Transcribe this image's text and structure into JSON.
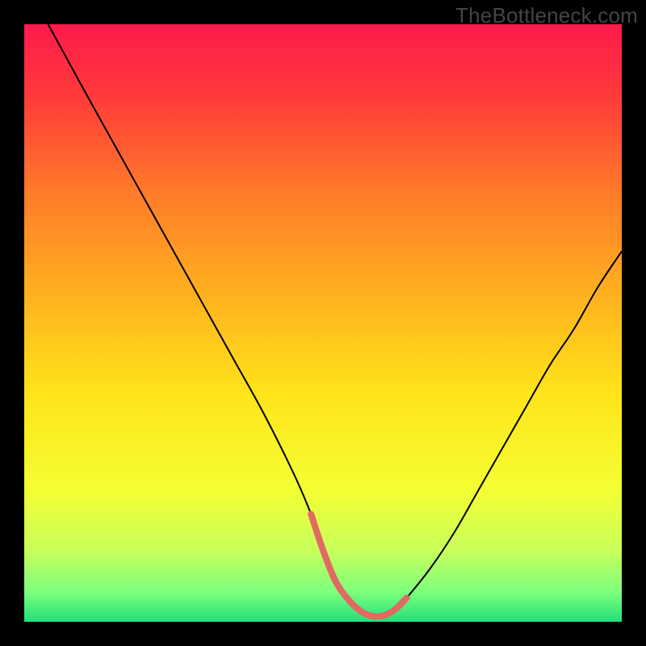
{
  "watermark": "TheBottleneck.com",
  "chart_data": {
    "type": "line",
    "title": "",
    "xlabel": "",
    "ylabel": "",
    "xlim": [
      0,
      100
    ],
    "ylim": [
      0,
      100
    ],
    "grid": false,
    "series": [
      {
        "name": "curve",
        "color": "#000000",
        "x": [
          4,
          10,
          15,
          20,
          25,
          30,
          35,
          40,
          45,
          48,
          50,
          52,
          54,
          56,
          58,
          60,
          62,
          64,
          68,
          72,
          76,
          80,
          84,
          88,
          92,
          96,
          100
        ],
        "y": [
          100,
          89,
          80,
          71,
          62,
          53,
          44,
          35,
          25,
          18,
          12,
          7,
          4,
          2,
          1,
          1,
          2,
          4,
          9,
          15,
          22,
          29,
          36,
          43,
          49,
          56,
          62
        ]
      },
      {
        "name": "highlight",
        "color": "#e16a62",
        "x": [
          48,
          50,
          52,
          54,
          56,
          58,
          60,
          62,
          64
        ],
        "y": [
          18,
          12,
          7,
          4,
          2,
          1,
          1,
          2,
          4
        ]
      }
    ],
    "gradient_stops": [
      {
        "offset": 0.0,
        "color": "#ff1a4d"
      },
      {
        "offset": 0.12,
        "color": "#ff3a3a"
      },
      {
        "offset": 0.28,
        "color": "#ff7a2a"
      },
      {
        "offset": 0.45,
        "color": "#ffb01f"
      },
      {
        "offset": 0.62,
        "color": "#ffe41a"
      },
      {
        "offset": 0.78,
        "color": "#f4ff33"
      },
      {
        "offset": 0.88,
        "color": "#c8ff5a"
      },
      {
        "offset": 0.95,
        "color": "#7dff7d"
      },
      {
        "offset": 1.0,
        "color": "#22e07a"
      }
    ]
  }
}
